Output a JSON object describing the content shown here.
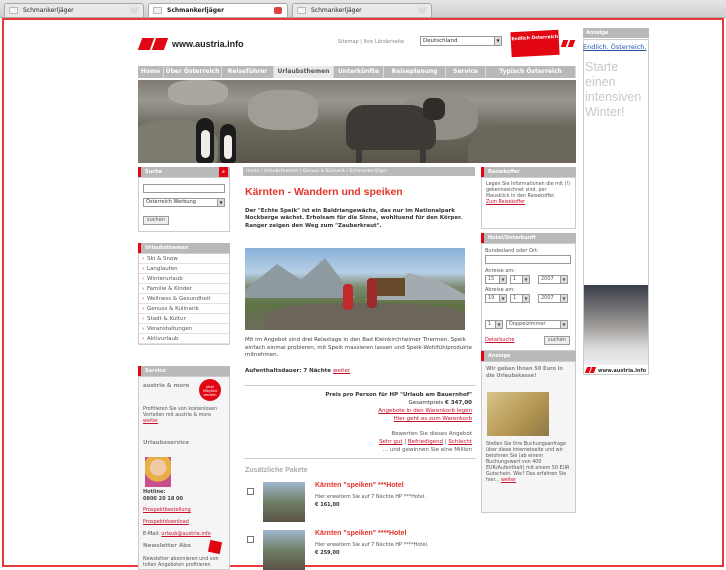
{
  "browser": {
    "tabs": [
      {
        "label": "Schmankerljäger",
        "active": false
      },
      {
        "label": "Schmankerljäger",
        "active": true
      },
      {
        "label": "Schmankerljäger",
        "active": false
      }
    ]
  },
  "header": {
    "logo_text": "www.austria.info",
    "top_links": "Sitemap | Ihre Länderseite",
    "country_select": "Deutschland",
    "badge_text": "Endlich Österreich"
  },
  "nav": {
    "items": [
      "Home",
      "Über Österreich",
      "Reiseführer",
      "Urlaubsthemen",
      "Unterkünfte",
      "Reiseplanung",
      "Service",
      "Typisch Österreich"
    ],
    "active_index": 3
  },
  "left": {
    "search": {
      "title": "Suche",
      "select": "Österreich Werbung",
      "button": "suchen"
    },
    "themes": {
      "title": "Urlaubsthemen",
      "items": [
        "Ski & Snow",
        "Langlaufen",
        "Winterurlaub",
        "Familie & Kinder",
        "Wellness & Gesundheit",
        "Genuss & Kulinarik",
        "Stadt & Kultur",
        "Veranstaltungen",
        "Aktivurlaub"
      ]
    },
    "service": {
      "title": "Service",
      "promo_title": "austria & more",
      "promo_text": "Profitieren Sie von kostenlosen Vorteilen mit austria & more",
      "promo_link": "weiter",
      "badge": "Jetzt Mitglied werden",
      "urlaubsservice": "Urlaubsservice",
      "hotline_label": "Hotline:",
      "hotline_number": "0800 20 18 00",
      "link1": "Prospektbestellung",
      "link2": "Prospektdownload",
      "email_label": "E-Mail:",
      "email": "urlaub@austria.info",
      "newsletter_title": "Newsletter Abo",
      "newsletter_text": "Newsletter abonnieren und von tollen Angeboten profitieren"
    }
  },
  "main": {
    "breadcrumb": "Home / Urlaubsthemen / Genuss & Kulinarik / Schmankerljäger",
    "title": "Kärnten - Wandern und speiken",
    "intro": "Der \"Echte Speik\" ist ein Baldriangewächs, das nur im Nationalpark Nockberge wächst. Erholsam für die Sinne, wohltuend für den Körper. Ranger zeigen den Weg zum \"Zauberkraut\".",
    "body": "Mit im Angebot sind drei Relaxtage in den Bad Kleinkirchheimer Thermen. Speik einfach einmal probieren, mit Speik massieren lassen und Speik-Wohlfühlprodukte mitnehmen.",
    "duration_label": "Aufenthaltsdauer: 7 Nächte",
    "duration_link": "weiter",
    "price": {
      "heading": "Preis pro Person für HP \"Urlaub am Bauernhof\"",
      "total_label": "Gesamtpreis",
      "total": "€ 347,00",
      "link1": "Angebote in den Warenkorb legen",
      "link2": "Hier geht es zum Warenkorb",
      "rate_label": "Bewerten Sie dieses Angebot",
      "rate1": "Sehr gut",
      "rate2": "Befriedigend",
      "rate3": "Schlecht",
      "rate_tail": "... und gewinnen Sie eine Million"
    },
    "packages_title": "Zusätzliche Pakete",
    "packages": [
      {
        "title": "Kärnten \"speiken\" ***Hotel",
        "desc": "Hier erweitern Sie auf 7 Nächte HP ***Hotel.",
        "price": "€ 161,00"
      },
      {
        "title": "Kärnten \"speiken\" ****Hotel",
        "desc": "Hier erweitern Sie auf 7 Nächte HP ****Hotel.",
        "price": "€ 259,00"
      }
    ]
  },
  "right": {
    "reisekoffer": {
      "title": "Reisekoffer",
      "text": "Legen Sie Informationen die mit (!) gekennzeichnet sind, per Mausklick in den Reisekoffer.",
      "link": "Zum Reisekoffer"
    },
    "hotel": {
      "title": "Hotel/Unterkunft",
      "field_label": "Bundesland oder Ort:",
      "arrival_label": "Anreise am:",
      "departure_label": "Abreise am:",
      "arr_day": "15",
      "arr_month": "1",
      "arr_year": "2007",
      "dep_day": "19",
      "dep_month": "1",
      "dep_year": "2007",
      "rooms": "1",
      "room_type": "Doppelzimmer",
      "detail_link": "Detailsuche",
      "search_button": "suchen"
    },
    "promo": {
      "title": "Anzeige",
      "headline": "Wir geben Ihnen 50 Euro in die Urlaubskasse!",
      "text": "Stellen Sie Ihre Buchungsanfrage über diese Internetseite und wir belohnen Sie (ab einem Buchungswert von 400 EUR/Aufenthalt) mit einem 50 EUR Gutschein. Wie? Das erfahren Sie hier...",
      "link": "weiter"
    }
  },
  "ad": {
    "label": "Anzeige",
    "link": "Endlich. Österreich.",
    "text": "Starte einen intensiven Winter!",
    "footer": "www.austria.info"
  }
}
